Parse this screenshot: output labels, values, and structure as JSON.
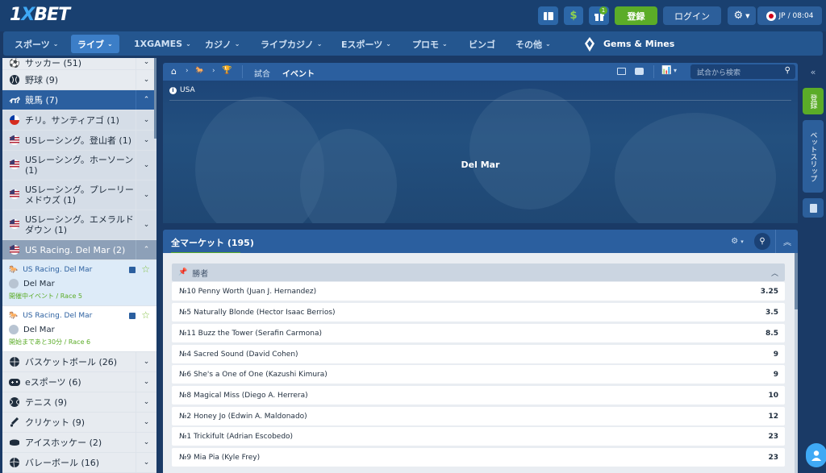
{
  "header": {
    "logo_one": "1",
    "logo_x": "X",
    "logo_bet": "BET",
    "register_label": "登録",
    "login_label": "ログイン",
    "gift_badge": "1",
    "lang_label": "JP",
    "time_label": "/ 08:04"
  },
  "nav": {
    "items": [
      {
        "label": "スポーツ",
        "chevron": true
      },
      {
        "label": "ライブ",
        "chevron": true
      },
      {
        "label": "1XGAMES",
        "chevron": true
      },
      {
        "label": "カジノ",
        "chevron": true
      },
      {
        "label": "ライブカジノ",
        "chevron": true
      },
      {
        "label": "Eスポーツ",
        "chevron": true
      },
      {
        "label": "プロモ",
        "chevron": true
      },
      {
        "label": "ビンゴ",
        "chevron": false
      },
      {
        "label": "その他",
        "chevron": true
      },
      {
        "label": "Gems & Mines",
        "chevron": false
      }
    ]
  },
  "sidebar": {
    "rows": [
      {
        "label": "サッカー (51)",
        "icon": "soccer-icon"
      },
      {
        "label": "野球 (9)",
        "icon": "baseball-icon"
      },
      {
        "label": "競馬 (7)",
        "icon": "horse-racing-icon"
      },
      {
        "label": "チリ。サンティアゴ (1)",
        "icon": "chile-flag-icon"
      },
      {
        "label": "USレーシング。登山者 (1)",
        "icon": "us-flag-icon"
      },
      {
        "label": "USレーシング。ホーソーン (1)",
        "icon": "us-flag-icon"
      },
      {
        "label": "USレーシング。プレーリーメドウズ (1)",
        "icon": "us-flag-icon"
      },
      {
        "label": "USレーシング。エメラルドダウン (1)",
        "icon": "us-flag-icon"
      },
      {
        "label": "US Racing. Del Mar (2)",
        "icon": "us-flag-icon"
      }
    ],
    "events": [
      {
        "league": "US Racing. Del Mar",
        "name": "Del Mar",
        "status": "開催中イベント / Race 5"
      },
      {
        "league": "US Racing. Del Mar",
        "name": "Del Mar",
        "status": "開始まであと30分 / Race 6"
      }
    ],
    "sports": [
      {
        "label": "バスケットボール (26)",
        "icon": "basketball-icon"
      },
      {
        "label": "eスポーツ (6)",
        "icon": "gamepad-icon"
      },
      {
        "label": "テニス (9)",
        "icon": "tennis-icon"
      },
      {
        "label": "クリケット (9)",
        "icon": "cricket-icon"
      },
      {
        "label": "アイスホッケー (2)",
        "icon": "hockey-puck-icon"
      },
      {
        "label": "バレーボール (16)",
        "icon": "volleyball-icon"
      }
    ]
  },
  "main": {
    "tab_match": "試合",
    "tab_event": "イベント",
    "search_placeholder": "試合から検索",
    "banner": {
      "country": "USA",
      "title": "Del Mar"
    },
    "markets_label": "全マーケット (195)",
    "group_label": "勝者",
    "markets": [
      {
        "name": "№10 Penny Worth (Juan J. Hernandez)",
        "odd": "3.25"
      },
      {
        "name": "№5 Naturally Blonde (Hector Isaac Berrios)",
        "odd": "3.5"
      },
      {
        "name": "№11 Buzz the Tower (Serafin Carmona)",
        "odd": "8.5"
      },
      {
        "name": "№4 Sacred Sound (David Cohen)",
        "odd": "9"
      },
      {
        "name": "№6 She's a One of One (Kazushi Kimura)",
        "odd": "9"
      },
      {
        "name": "№8 Magical Miss (Diego A. Herrera)",
        "odd": "10"
      },
      {
        "name": "№2 Honey Jo (Edwin A. Maldonado)",
        "odd": "12"
      },
      {
        "name": "№1 Trickifult (Adrian Escobedo)",
        "odd": "23"
      },
      {
        "name": "№9 Mia Pia (Kyle Frey)",
        "odd": "23"
      }
    ]
  },
  "rail": {
    "register_label": "登録",
    "betslip_label": "ベットスリップ"
  },
  "colors": {
    "header_bg": "#194070",
    "accent_green": "#5bac28",
    "panel_blue": "#2b5f9f"
  }
}
